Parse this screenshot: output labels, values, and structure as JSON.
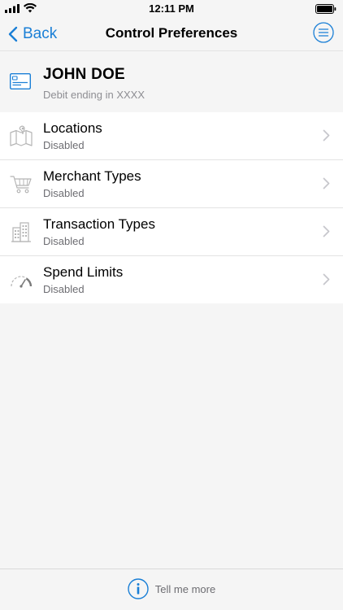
{
  "status_bar": {
    "time": "12:11 PM"
  },
  "nav": {
    "back_label": "Back",
    "title": "Control Preferences"
  },
  "account": {
    "name": "JOHN DOE",
    "subtitle": "Debit ending in XXXX"
  },
  "list": {
    "items": [
      {
        "title": "Locations",
        "status": "Disabled",
        "icon": "map-icon"
      },
      {
        "title": "Merchant Types",
        "status": "Disabled",
        "icon": "cart-icon"
      },
      {
        "title": "Transaction Types",
        "status": "Disabled",
        "icon": "buildings-icon"
      },
      {
        "title": "Spend Limits",
        "status": "Disabled",
        "icon": "speedometer-icon"
      }
    ]
  },
  "footer": {
    "tell_more_label": "Tell me more"
  },
  "colors": {
    "accent": "#1a7fd6",
    "background": "#f5f5f5",
    "secondary_text": "#8e8e93",
    "icon_gray": "#b5b5b5"
  }
}
